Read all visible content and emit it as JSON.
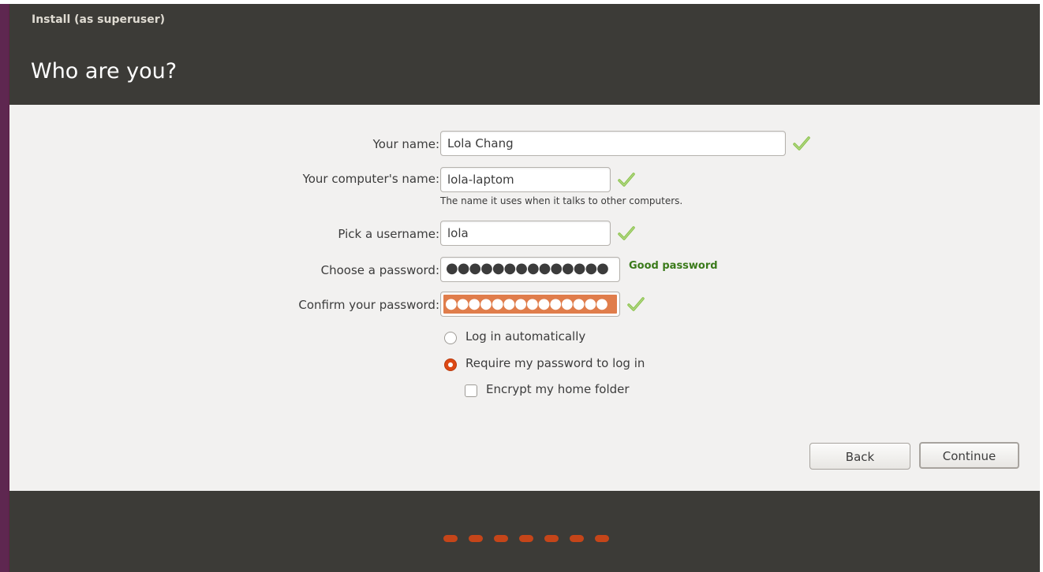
{
  "window": {
    "title": "Install (as superuser)",
    "heading": "Who are you?"
  },
  "form": {
    "name": {
      "label": "Your name:",
      "value": "Lola Chang",
      "valid": true
    },
    "computer": {
      "label": "Your computer's name:",
      "value": "lola-laptom",
      "hint": "The name it uses when it talks to other computers.",
      "valid": true
    },
    "username": {
      "label": "Pick a username:",
      "value": "lola",
      "valid": true
    },
    "password": {
      "label": "Choose a password:",
      "masked": "●●●●●●●●●●●●●●",
      "strength": "Good password"
    },
    "confirm": {
      "label": "Confirm your password:",
      "masked": "●●●●●●●●●●●●●●",
      "valid": true
    },
    "login_options": {
      "auto": {
        "label": "Log in automatically",
        "selected": false
      },
      "require": {
        "label": "Require my password to log in",
        "selected": true
      },
      "encrypt": {
        "label": "Encrypt my home folder",
        "checked": false
      }
    }
  },
  "buttons": {
    "back": "Back",
    "continue": "Continue"
  },
  "progress": {
    "steps": 7
  },
  "colors": {
    "accent": "#dd4814",
    "header_bg": "#3c3b37",
    "check_green": "#7cb342",
    "good_password": "#3a7a1a"
  }
}
